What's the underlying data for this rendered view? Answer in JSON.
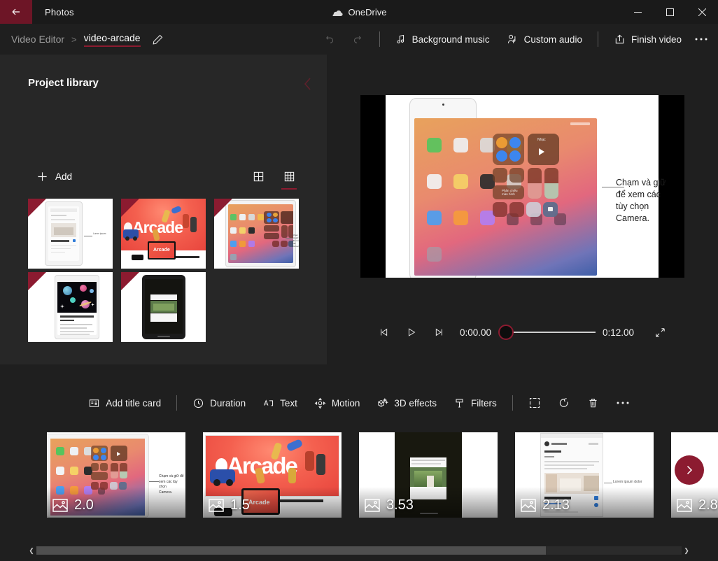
{
  "titlebar": {
    "back_icon": "back-arrow-icon",
    "app_title": "Photos",
    "cloud_icon": "onedrive-cloud-icon",
    "onedrive_label": "OneDrive",
    "minimize_label": "Minimize",
    "maximize_label": "Maximize",
    "close_label": "Close"
  },
  "commandbar": {
    "breadcrumb_parent": "Video Editor",
    "breadcrumb_separator": ">",
    "breadcrumb_current": "video-arcade",
    "rename_icon": "pencil-icon",
    "undo_icon": "undo-icon",
    "redo_icon": "redo-icon",
    "background_music": "Background music",
    "background_music_icon": "music-note-icon",
    "custom_audio": "Custom audio",
    "custom_audio_icon": "person-audio-icon",
    "finish_video": "Finish video",
    "finish_video_icon": "share-export-icon",
    "more_icon": "ellipsis-icon"
  },
  "library": {
    "title": "Project library",
    "collapse_icon": "chevron-left-icon",
    "add_label": "Add",
    "add_icon": "plus-icon",
    "view_large_icon": "grid-large-icon",
    "view_small_icon": "grid-small-icon",
    "view_selected": "grid-small-icon",
    "items": [
      {
        "name": "ipad-article-thumbnail",
        "kind": "document"
      },
      {
        "name": "apple-arcade-thumbnail",
        "kind": "arcade"
      },
      {
        "name": "ios-control-center-thumbnail",
        "kind": "ios"
      },
      {
        "name": "ipad-space-article-thumbnail",
        "kind": "space"
      },
      {
        "name": "ipad-dark-article-thumbnail",
        "kind": "dark"
      }
    ]
  },
  "preview": {
    "callout_text": "Chạm và giữ để xem các tùy chọn Camera.",
    "previous_frame_icon": "previous-frame-icon",
    "play_icon": "play-icon",
    "next_frame_icon": "next-frame-icon",
    "current_time": "0:00.00",
    "total_time": "0:12.00",
    "fullscreen_icon": "fullscreen-icon",
    "scrubber_position_pct": 0
  },
  "storyboard": {
    "toolbar": [
      {
        "label": "Add title card",
        "icon": "title-card-icon",
        "type": "item"
      },
      {
        "type": "divider"
      },
      {
        "label": "Duration",
        "icon": "clock-icon",
        "type": "item"
      },
      {
        "label": "Text",
        "icon": "text-icon",
        "type": "item"
      },
      {
        "label": "Motion",
        "icon": "motion-icon",
        "type": "item"
      },
      {
        "label": "3D effects",
        "icon": "cube-sparkle-icon",
        "type": "item"
      },
      {
        "label": "Filters",
        "icon": "filter-brush-icon",
        "type": "item"
      },
      {
        "type": "divider"
      },
      {
        "label": "",
        "icon": "crop-icon",
        "type": "icon-only"
      },
      {
        "label": "",
        "icon": "rotate-icon",
        "type": "icon-only"
      },
      {
        "label": "",
        "icon": "delete-icon",
        "type": "icon-only"
      },
      {
        "label": "",
        "icon": "ellipsis-icon",
        "type": "icon-only"
      }
    ],
    "clips": [
      {
        "duration": "2.0",
        "kind": "ios",
        "selected": true,
        "media_icon": "image-icon"
      },
      {
        "duration": "1.5",
        "kind": "arcade",
        "selected": false,
        "media_icon": "image-icon"
      },
      {
        "duration": "3.53",
        "kind": "dark",
        "selected": false,
        "media_icon": "image-icon"
      },
      {
        "duration": "2.13",
        "kind": "doc",
        "selected": false,
        "media_icon": "image-icon"
      },
      {
        "duration": "2.8",
        "kind": "space",
        "selected": false,
        "media_icon": "image-icon"
      }
    ],
    "next_icon": "chevron-right-icon",
    "scroll_left_icon": "scroll-left-icon",
    "scroll_right_icon": "scroll-right-icon"
  },
  "colors": {
    "accent": "#8c1b30",
    "accent_bright": "#c22340",
    "window_bg": "#1f1f1f",
    "panel_bg": "#272727",
    "titlebar_bg": "#1a1a1a"
  }
}
